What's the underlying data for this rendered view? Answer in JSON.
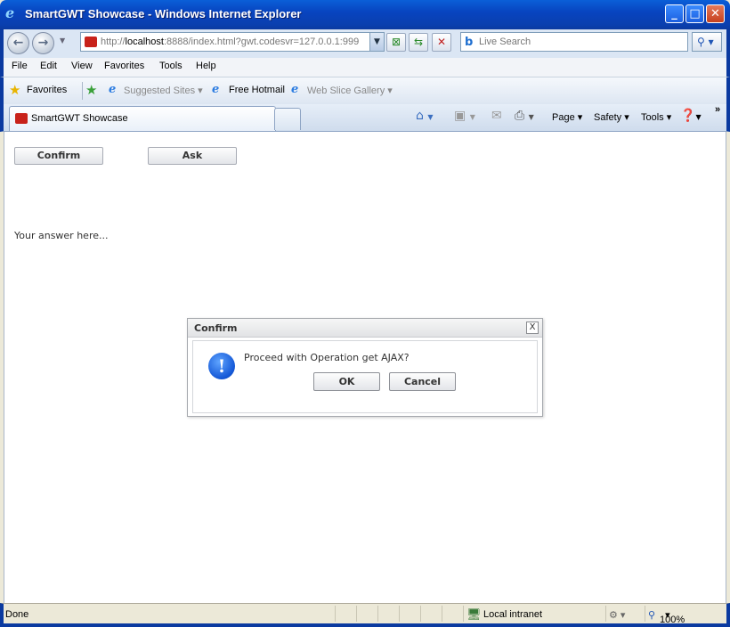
{
  "window": {
    "title": "SmartGWT Showcase - Windows Internet Explorer"
  },
  "addressbar": {
    "url_prefix": "http://",
    "url_host": "localhost",
    "url_rest": ":8888/index.html?gwt.codesvr=127.0.0.1:999",
    "search_placeholder": "Live Search"
  },
  "menubar": {
    "items": [
      "File",
      "Edit",
      "View",
      "Favorites",
      "Tools",
      "Help"
    ]
  },
  "favorites_bar": {
    "favorites_label": "Favorites",
    "links": [
      "Suggested Sites",
      "Free Hotmail",
      "Web Slice Gallery"
    ]
  },
  "tabs": {
    "active_tab": "SmartGWT Showcase"
  },
  "command_bar": {
    "page": "Page",
    "safety": "Safety",
    "tools": "Tools"
  },
  "content": {
    "confirm_button": "Confirm",
    "ask_button": "Ask",
    "answer_text": "Your answer here..."
  },
  "dialog": {
    "title": "Confirm",
    "close_glyph": "X",
    "message": "Proceed with Operation get AJAX?",
    "ok_button": "OK",
    "cancel_button": "Cancel"
  },
  "statusbar": {
    "status": "Done",
    "zone": "Local intranet",
    "zoom": "100%"
  },
  "colors": {
    "titlebar": "#0a5fd8",
    "dialog_icon": "#1357d6"
  }
}
